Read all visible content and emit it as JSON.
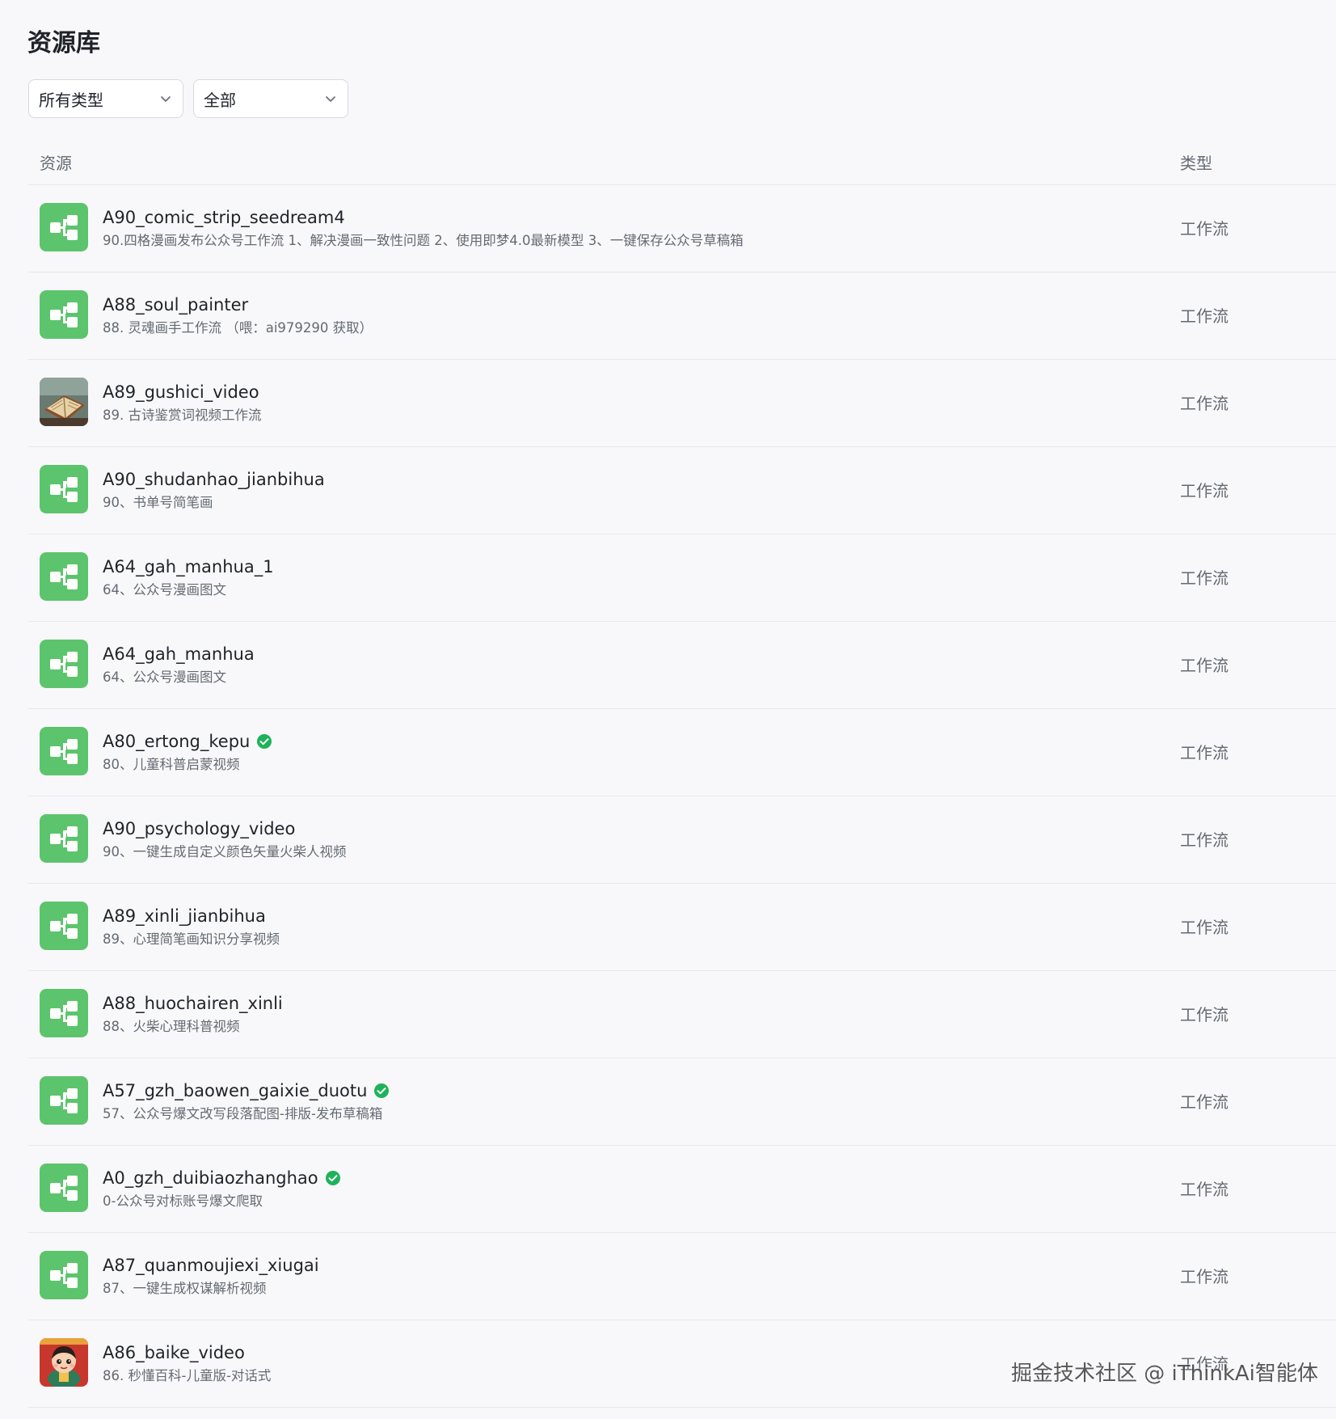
{
  "page_title": "资源库",
  "filters": {
    "type_select": "所有类型",
    "scope_select": "全部"
  },
  "table": {
    "col_resource": "资源",
    "col_type": "类型"
  },
  "colors": {
    "workflow_icon_bg": "#5cc46c",
    "verified": "#1fb25a"
  },
  "rows": [
    {
      "name": "A90_comic_strip_seedream4",
      "desc": "90.四格漫画发布公众号工作流 1、解决漫画一致性问题 2、使用即梦4.0最新模型 3、一键保存公众号草稿箱",
      "type": "工作流",
      "icon": "workflow-icon",
      "verified": false
    },
    {
      "name": "A88_soul_painter",
      "desc": "88. 灵魂画手工作流 （喂：ai979290 获取）",
      "type": "工作流",
      "icon": "workflow-icon",
      "verified": false
    },
    {
      "name": "A89_gushici_video",
      "desc": "89. 古诗鉴赏词视频工作流",
      "type": "工作流",
      "icon": "book-thumbnail-icon",
      "verified": false
    },
    {
      "name": "A90_shudanhao_jianbihua",
      "desc": "90、书单号简笔画",
      "type": "工作流",
      "icon": "workflow-icon",
      "verified": false
    },
    {
      "name": "A64_gah_manhua_1",
      "desc": "64、公众号漫画图文",
      "type": "工作流",
      "icon": "workflow-icon",
      "verified": false
    },
    {
      "name": "A64_gah_manhua",
      "desc": "64、公众号漫画图文",
      "type": "工作流",
      "icon": "workflow-icon",
      "verified": false
    },
    {
      "name": "A80_ertong_kepu",
      "desc": "80、儿童科普启蒙视频",
      "type": "工作流",
      "icon": "workflow-icon",
      "verified": true
    },
    {
      "name": "A90_psychology_video",
      "desc": "90、一键生成自定义颜色矢量火柴人视频",
      "type": "工作流",
      "icon": "workflow-icon",
      "verified": false
    },
    {
      "name": "A89_xinli_jianbihua",
      "desc": "89、心理简笔画知识分享视频",
      "type": "工作流",
      "icon": "workflow-icon",
      "verified": false
    },
    {
      "name": "A88_huochairen_xinli",
      "desc": "88、火柴心理科普视频",
      "type": "工作流",
      "icon": "workflow-icon",
      "verified": false
    },
    {
      "name": "A57_gzh_baowen_gaixie_duotu",
      "desc": "57、公众号爆文改写段落配图-排版-发布草稿箱",
      "type": "工作流",
      "icon": "workflow-icon",
      "verified": true
    },
    {
      "name": "A0_gzh_duibiaozhanghao",
      "desc": "0-公众号对标账号爆文爬取",
      "type": "工作流",
      "icon": "workflow-icon",
      "verified": true
    },
    {
      "name": "A87_quanmoujiexi_xiugai",
      "desc": "87、一键生成权谋解析视频",
      "type": "工作流",
      "icon": "workflow-icon",
      "verified": false
    },
    {
      "name": "A86_baike_video",
      "desc": "86. 秒懂百科-儿童版-对话式",
      "type": "工作流",
      "icon": "cartoon-avatar-icon",
      "verified": false
    }
  ],
  "watermark": "掘金技术社区 @ iThinkAi智能体"
}
